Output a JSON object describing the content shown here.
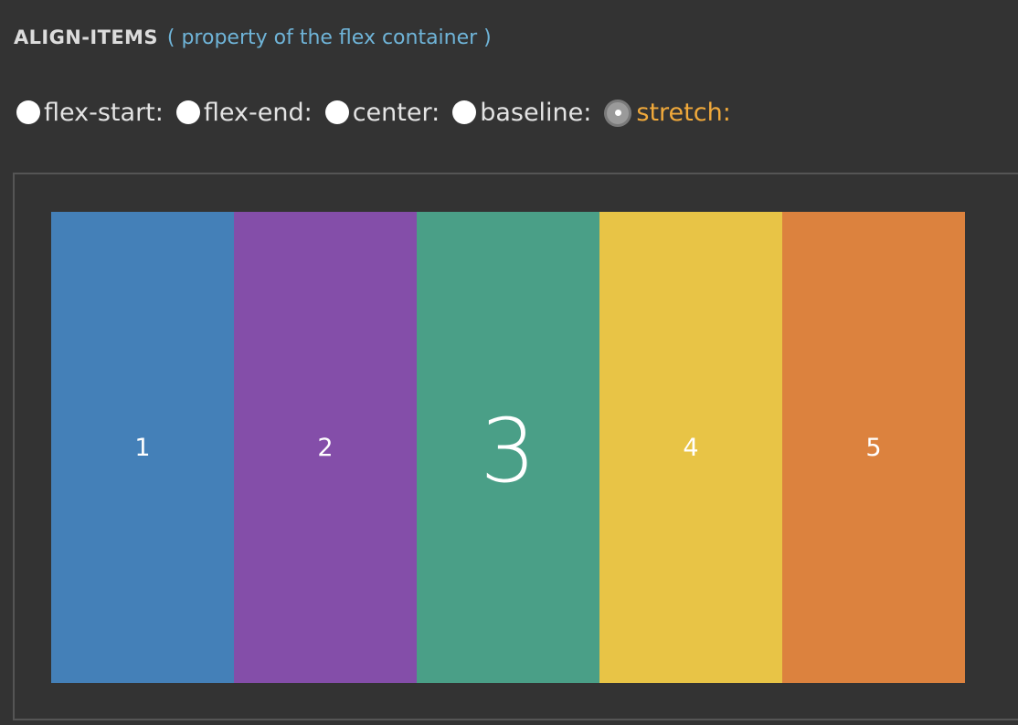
{
  "header": {
    "title": "ALIGN-ITEMS",
    "subtitle": "( property of the flex container )"
  },
  "options": [
    {
      "label": "flex-start:",
      "checked": false
    },
    {
      "label": "flex-end:",
      "checked": false
    },
    {
      "label": "center:",
      "checked": false
    },
    {
      "label": "baseline:",
      "checked": false
    },
    {
      "label": "stretch:",
      "checked": true
    }
  ],
  "items": [
    {
      "label": "1",
      "color": "#4480b8"
    },
    {
      "label": "2",
      "color": "#844ea9"
    },
    {
      "label": "3",
      "color": "#4a9f87"
    },
    {
      "label": "4",
      "color": "#e8c446"
    },
    {
      "label": "5",
      "color": "#dc823e"
    }
  ],
  "colors": {
    "background": "#333333",
    "title": "#dcdcdc",
    "subtitle": "#6fb4d8",
    "active_option": "#f0a93b",
    "option_text": "#e4e4e4",
    "container_border": "#555555"
  }
}
